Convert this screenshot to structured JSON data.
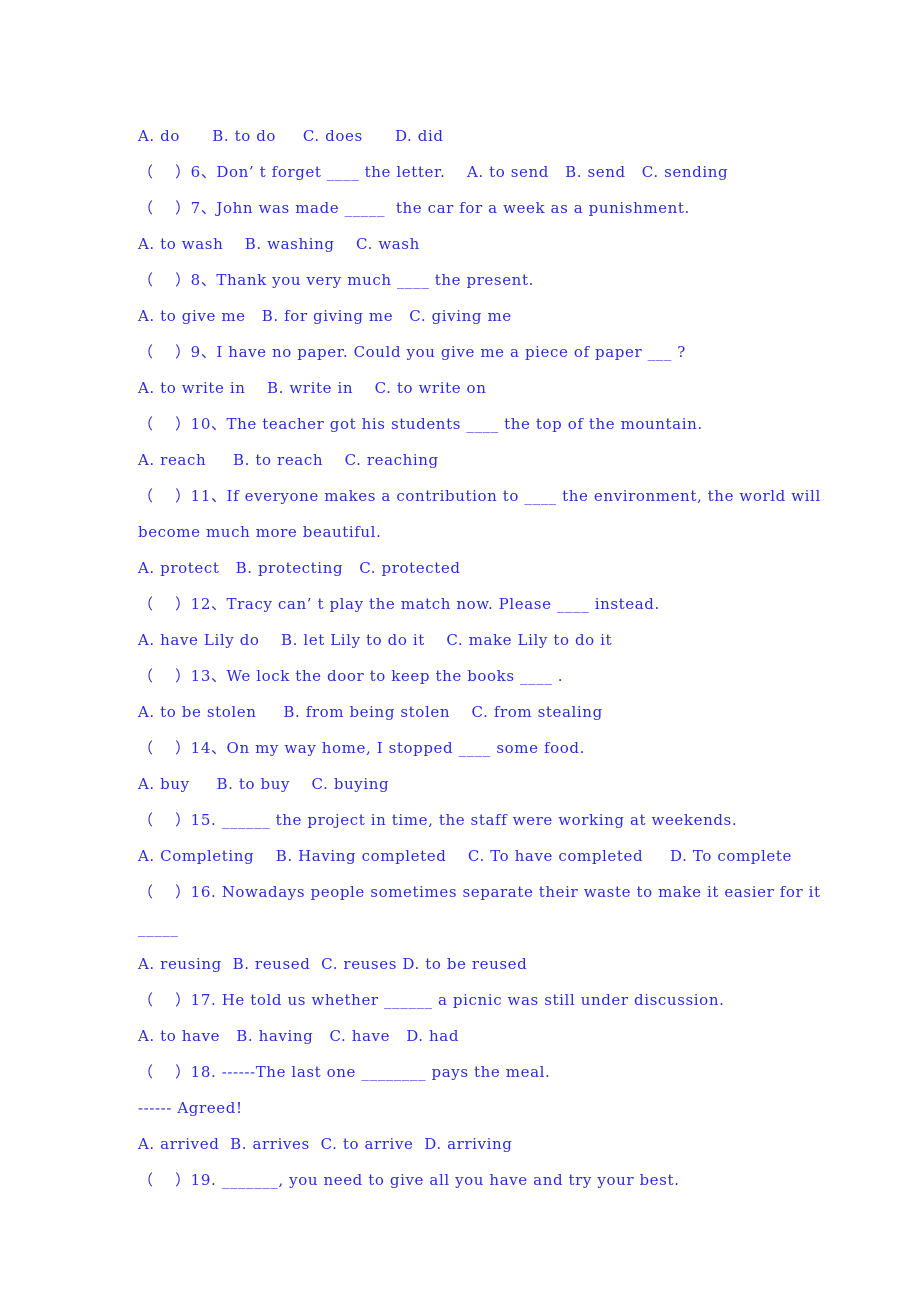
{
  "document": {
    "page_background": "#ffffff",
    "text_color": "#2B2BDD",
    "lines": [
      {
        "id": "opts-5",
        "text": "A. do      B. to do     C. does      D. did"
      },
      {
        "id": "q-6",
        "text": "（    ）6、Don’ t forget ____ the letter.    A. to send   B. send   C. sending"
      },
      {
        "id": "q-7",
        "text": "（    ）7、John was made _____  the car for a week as a punishment."
      },
      {
        "id": "opts-7",
        "text": "A. to wash    B. washing    C. wash"
      },
      {
        "id": "q-8",
        "text": "（    ）8、Thank you very much ____ the present."
      },
      {
        "id": "opts-8",
        "text": "A. to give me   B. for giving me   C. giving me"
      },
      {
        "id": "q-9",
        "text": "（    ）9、I have no paper. Could you give me a piece of paper ___ ?"
      },
      {
        "id": "opts-9",
        "text": "A. to write in    B. write in    C. to write on"
      },
      {
        "id": "q-10",
        "text": "（    ）10、The teacher got his students ____ the top of the mountain."
      },
      {
        "id": "opts-10",
        "text": "A. reach     B. to reach    C. reaching"
      },
      {
        "id": "q-11",
        "text": "（    ）11、If everyone makes a contribution to ____ the environment, the world will become much more beautiful."
      },
      {
        "id": "opts-11",
        "text": "A. protect   B. protecting   C. protected"
      },
      {
        "id": "q-12",
        "text": "（    ）12、Tracy can’ t play the match now. Please ____ instead."
      },
      {
        "id": "opts-12",
        "text": "A. have Lily do    B. let Lily to do it    C. make Lily to do it"
      },
      {
        "id": "q-13",
        "text": "（    ）13、We lock the door to keep the books ____ ."
      },
      {
        "id": "opts-13",
        "text": "A. to be stolen     B. from being stolen    C. from stealing"
      },
      {
        "id": "q-14",
        "text": "（    ）14、On my way home, I stopped ____ some food."
      },
      {
        "id": "opts-14",
        "text": "A. buy     B. to buy    C. buying"
      },
      {
        "id": "q-15",
        "text": "（    ）15. ______ the project in time, the staff were working at weekends."
      },
      {
        "id": "opts-15",
        "text": "A. Completing    B. Having completed    C. To have completed     D. To complete"
      },
      {
        "id": "q-16",
        "text": "（    ）16. Nowadays people sometimes separate their waste to make it easier for it"
      },
      {
        "id": "q-16-blank",
        "text": "_____"
      },
      {
        "id": "opts-16",
        "text": "A. reusing  B. reused  C. reuses D. to be reused"
      },
      {
        "id": "q-17",
        "text": "（    ）17. He told us whether ______ a picnic was still under discussion."
      },
      {
        "id": "opts-17",
        "text": "A. to have   B. having   C. have   D. had"
      },
      {
        "id": "q-18",
        "text": "（    ）18. ------The last one ________ pays the meal."
      },
      {
        "id": "q-18-reply",
        "text": "------ Agreed!"
      },
      {
        "id": "opts-18",
        "text": "A. arrived  B. arrives  C. to arrive  D. arriving"
      },
      {
        "id": "q-19",
        "text": "（    ）19. _______, you need to give all you have and try your best."
      }
    ]
  }
}
